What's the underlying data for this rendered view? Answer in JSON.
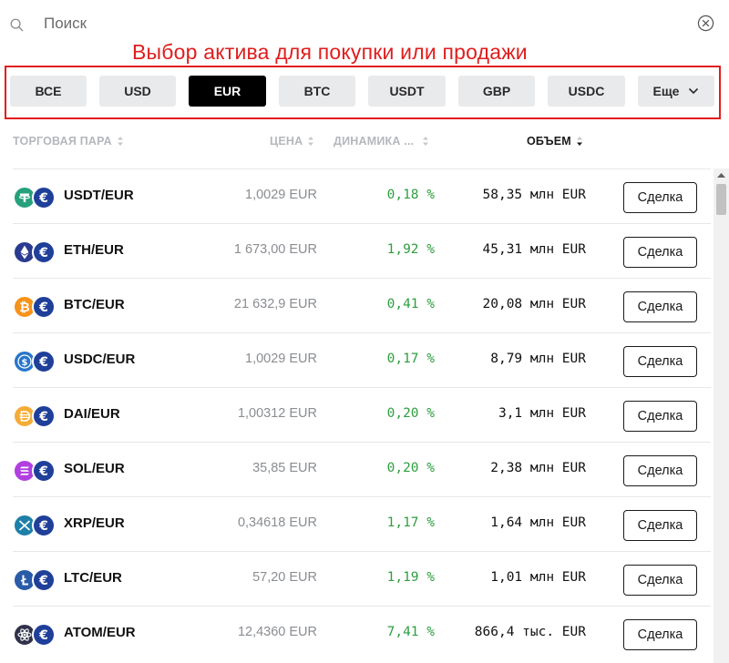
{
  "search": {
    "placeholder": "Поиск"
  },
  "annotation": {
    "text": "Выбор актива для покупки или продажи"
  },
  "filters": [
    {
      "label": "ВСЕ",
      "active": false
    },
    {
      "label": "USD",
      "active": false
    },
    {
      "label": "EUR",
      "active": true
    },
    {
      "label": "BTC",
      "active": false
    },
    {
      "label": "USDT",
      "active": false
    },
    {
      "label": "GBP",
      "active": false
    },
    {
      "label": "USDC",
      "active": false
    },
    {
      "label": "Еще",
      "active": false,
      "dropdown": true
    }
  ],
  "columns": {
    "pair": "ТОРГОВАЯ ПАРА",
    "price": "ЦЕНА",
    "change": "ДИНАМИКА ...",
    "volume": "ОБЪЕМ"
  },
  "rows": [
    {
      "pair": "USDT/EUR",
      "price": "1,0029 EUR",
      "change": "0,18 %",
      "volume": "58,35 млн EUR",
      "action": "Сделка",
      "icon": "tether-icon",
      "color": "#26a17b"
    },
    {
      "pair": "ETH/EUR",
      "price": "1 673,00 EUR",
      "change": "1,92 %",
      "volume": "45,31 млн EUR",
      "action": "Сделка",
      "icon": "ethereum-icon",
      "color": "#2a3b8f"
    },
    {
      "pair": "BTC/EUR",
      "price": "21 632,9 EUR",
      "change": "0,41 %",
      "volume": "20,08 млн EUR",
      "action": "Сделка",
      "icon": "bitcoin-icon",
      "color": "#f7931a"
    },
    {
      "pair": "USDC/EUR",
      "price": "1,0029 EUR",
      "change": "0,17 %",
      "volume": "8,79 млн EUR",
      "action": "Сделка",
      "icon": "usdc-icon",
      "color": "#2775ca"
    },
    {
      "pair": "DAI/EUR",
      "price": "1,00312 EUR",
      "change": "0,20 %",
      "volume": "3,1 млн EUR",
      "action": "Сделка",
      "icon": "dai-icon",
      "color": "#f5ac37"
    },
    {
      "pair": "SOL/EUR",
      "price": "35,85 EUR",
      "change": "0,20 %",
      "volume": "2,38 млн EUR",
      "action": "Сделка",
      "icon": "solana-icon",
      "color": "#b13fe0"
    },
    {
      "pair": "XRP/EUR",
      "price": "0,34618 EUR",
      "change": "1,17 %",
      "volume": "1,64 млн EUR",
      "action": "Сделка",
      "icon": "xrp-icon",
      "color": "#1e7fa8"
    },
    {
      "pair": "LTC/EUR",
      "price": "57,20 EUR",
      "change": "1,19 %",
      "volume": "1,01 млн EUR",
      "action": "Сделка",
      "icon": "litecoin-icon",
      "color": "#2a5ba8"
    },
    {
      "pair": "ATOM/EUR",
      "price": "12,4360 EUR",
      "change": "7,41 %",
      "volume": "866,4 тыс. EUR",
      "action": "Сделка",
      "icon": "cosmos-icon",
      "color": "#2e3148"
    }
  ],
  "quote_icon": "euro-icon",
  "colors": {
    "accent": "#000000",
    "annotation": "#e11d1d",
    "positive": "#2e9e3f",
    "euro": "#1f3f99"
  }
}
